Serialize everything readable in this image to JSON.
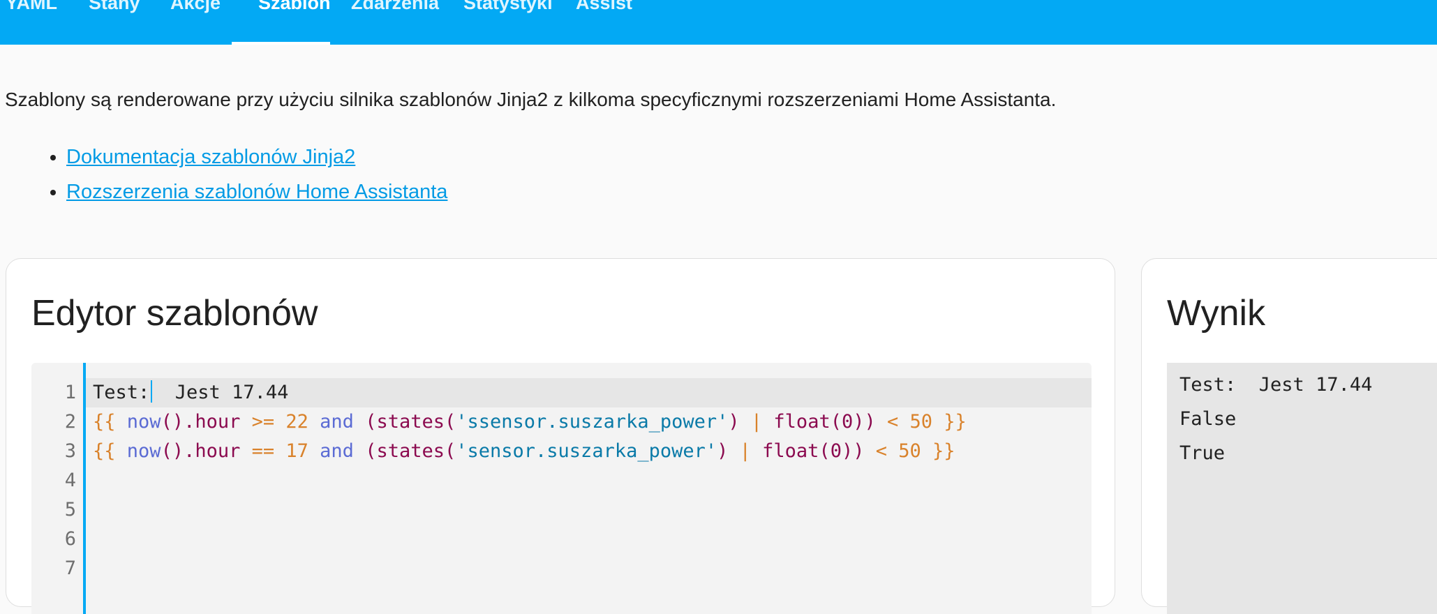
{
  "tabs": [
    {
      "label": "YAML",
      "active": false
    },
    {
      "label": "Stany",
      "active": false
    },
    {
      "label": "Akcje",
      "active": false
    },
    {
      "label": "Szablon",
      "active": true
    },
    {
      "label": "Zdarzenia",
      "active": false
    },
    {
      "label": "Statystyki",
      "active": false
    },
    {
      "label": "Assist",
      "active": false
    }
  ],
  "intro": {
    "text": "Szablony są renderowane przy użyciu silnika szablonów Jinja2 z kilkoma specyficznymi rozszerzeniami Home Assistanta.",
    "links": [
      {
        "label": "Dokumentacja szablonów Jinja2"
      },
      {
        "label": "Rozszerzenia szablonów Home Assistanta"
      }
    ]
  },
  "editor": {
    "title": "Edytor szablonów",
    "line_numbers": [
      "1",
      "2",
      "3",
      "4",
      "5",
      "6",
      "7"
    ],
    "lines": [
      [
        {
          "t": "Test:",
          "c": ""
        },
        {
          "t": "CARET",
          "c": "caret"
        },
        {
          "t": "  Jest 17.44",
          "c": ""
        }
      ],
      [
        {
          "t": "{{ ",
          "c": "tok-brace"
        },
        {
          "t": "now",
          "c": "tok-fn"
        },
        {
          "t": "().hour ",
          "c": "tok-plain"
        },
        {
          "t": ">= ",
          "c": "tok-op"
        },
        {
          "t": "22 ",
          "c": "tok-num"
        },
        {
          "t": "and ",
          "c": "tok-kw"
        },
        {
          "t": "(states(",
          "c": "tok-call"
        },
        {
          "t": "'ssensor.suszarka_power'",
          "c": "tok-str"
        },
        {
          "t": ") ",
          "c": "tok-call"
        },
        {
          "t": "| ",
          "c": "tok-op"
        },
        {
          "t": "float(0)) ",
          "c": "tok-call"
        },
        {
          "t": "< ",
          "c": "tok-op"
        },
        {
          "t": "50 ",
          "c": "tok-num"
        },
        {
          "t": "}}",
          "c": "tok-brace"
        }
      ],
      [
        {
          "t": "{{ ",
          "c": "tok-brace"
        },
        {
          "t": "now",
          "c": "tok-fn"
        },
        {
          "t": "().hour ",
          "c": "tok-plain"
        },
        {
          "t": "== ",
          "c": "tok-op"
        },
        {
          "t": "17 ",
          "c": "tok-num"
        },
        {
          "t": "and ",
          "c": "tok-kw"
        },
        {
          "t": "(states(",
          "c": "tok-call"
        },
        {
          "t": "'sensor.suszarka_power'",
          "c": "tok-str"
        },
        {
          "t": ") ",
          "c": "tok-call"
        },
        {
          "t": "| ",
          "c": "tok-op"
        },
        {
          "t": "float(0)) ",
          "c": "tok-call"
        },
        {
          "t": "< ",
          "c": "tok-op"
        },
        {
          "t": "50 ",
          "c": "tok-num"
        },
        {
          "t": "}}",
          "c": "tok-brace"
        }
      ],
      [],
      [],
      [],
      []
    ],
    "active_line": 0
  },
  "result": {
    "title": "Wynik",
    "lines": [
      "Test:  Jest 17.44",
      "False",
      "True"
    ]
  },
  "colors": {
    "header": "#03a9f4",
    "link": "#039be5",
    "accent": "#03a9f4"
  }
}
